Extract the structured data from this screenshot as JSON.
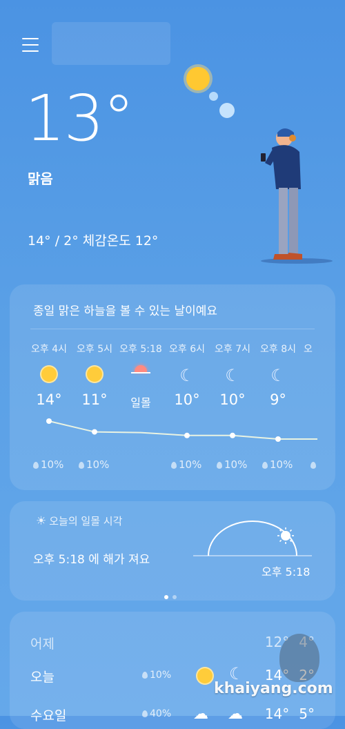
{
  "header": {
    "menu_icon": "hamburger-icon"
  },
  "current": {
    "temperature": "13°",
    "condition": "맑음",
    "hi_lo_feels": "14° / 2° 체감온도 12°"
  },
  "hourly_card": {
    "summary": "종일 맑은 하늘을 볼 수 있는 날이예요",
    "hours": [
      {
        "time": "오후 4시",
        "icon": "sun-icon",
        "temp": "14°",
        "precip": "10%"
      },
      {
        "time": "오후 5시",
        "icon": "sun-icon",
        "temp": "11°",
        "precip": "10%"
      },
      {
        "time": "오후 5:18",
        "icon": "sunset-icon",
        "temp": "일몰",
        "precip": ""
      },
      {
        "time": "오후 6시",
        "icon": "moon-icon",
        "temp": "10°",
        "precip": "10%"
      },
      {
        "time": "오후 7시",
        "icon": "moon-icon",
        "temp": "10°",
        "precip": "10%"
      },
      {
        "time": "오후 8시",
        "icon": "moon-icon",
        "temp": "9°",
        "precip": "10%"
      },
      {
        "time": "오",
        "icon": "",
        "temp": "",
        "precip": ""
      }
    ],
    "chart_data": {
      "type": "line",
      "values": [
        14,
        11,
        10.8,
        10,
        10,
        9,
        9
      ]
    }
  },
  "sunset_card": {
    "label": "오늘의 일몰 시각",
    "message": "오후 5:18 에 해가 져요",
    "time": "오후 5:18",
    "page_index": 0,
    "page_count": 2
  },
  "daily": [
    {
      "day": "어제",
      "precip": "",
      "high": "12°",
      "low": "4°",
      "icons": []
    },
    {
      "day": "오늘",
      "precip": "10%",
      "high": "14°",
      "low": "2°",
      "icons": [
        "sun-icon",
        "moon-icon"
      ]
    },
    {
      "day": "수요일",
      "precip": "40%",
      "high": "14°",
      "low": "5°",
      "icons": [
        "cloud-icon",
        "cloud-icon"
      ]
    }
  ],
  "watermark": "khaiyang.com",
  "colors": {
    "accent": "#ffc831",
    "sunset": "#ff8a80",
    "bg_top": "#4b93e3"
  }
}
